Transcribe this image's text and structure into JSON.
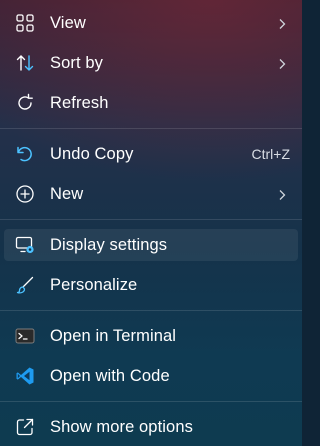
{
  "menu": {
    "items": [
      {
        "label": "View",
        "icon": "grid-icon",
        "has_submenu": true
      },
      {
        "label": "Sort by",
        "icon": "sort-arrows-icon",
        "has_submenu": true
      },
      {
        "label": "Refresh",
        "icon": "refresh-icon",
        "has_submenu": false
      },
      {
        "label": "Undo Copy",
        "icon": "undo-icon",
        "shortcut": "Ctrl+Z",
        "has_submenu": false
      },
      {
        "label": "New",
        "icon": "plus-circle-icon",
        "has_submenu": true
      },
      {
        "label": "Display settings",
        "icon": "display-settings-icon",
        "has_submenu": false
      },
      {
        "label": "Personalize",
        "icon": "brush-icon",
        "has_submenu": false
      },
      {
        "label": "Open in Terminal",
        "icon": "terminal-icon",
        "has_submenu": false
      },
      {
        "label": "Open with Code",
        "icon": "vscode-icon",
        "has_submenu": false
      },
      {
        "label": "Show more options",
        "icon": "share-icon",
        "has_submenu": false
      }
    ]
  },
  "colors": {
    "accent": "#4cc2ff",
    "vscode_blue": "#1e9bf0",
    "text": "#ffffff",
    "shortcut_text": "#d8dde4"
  }
}
